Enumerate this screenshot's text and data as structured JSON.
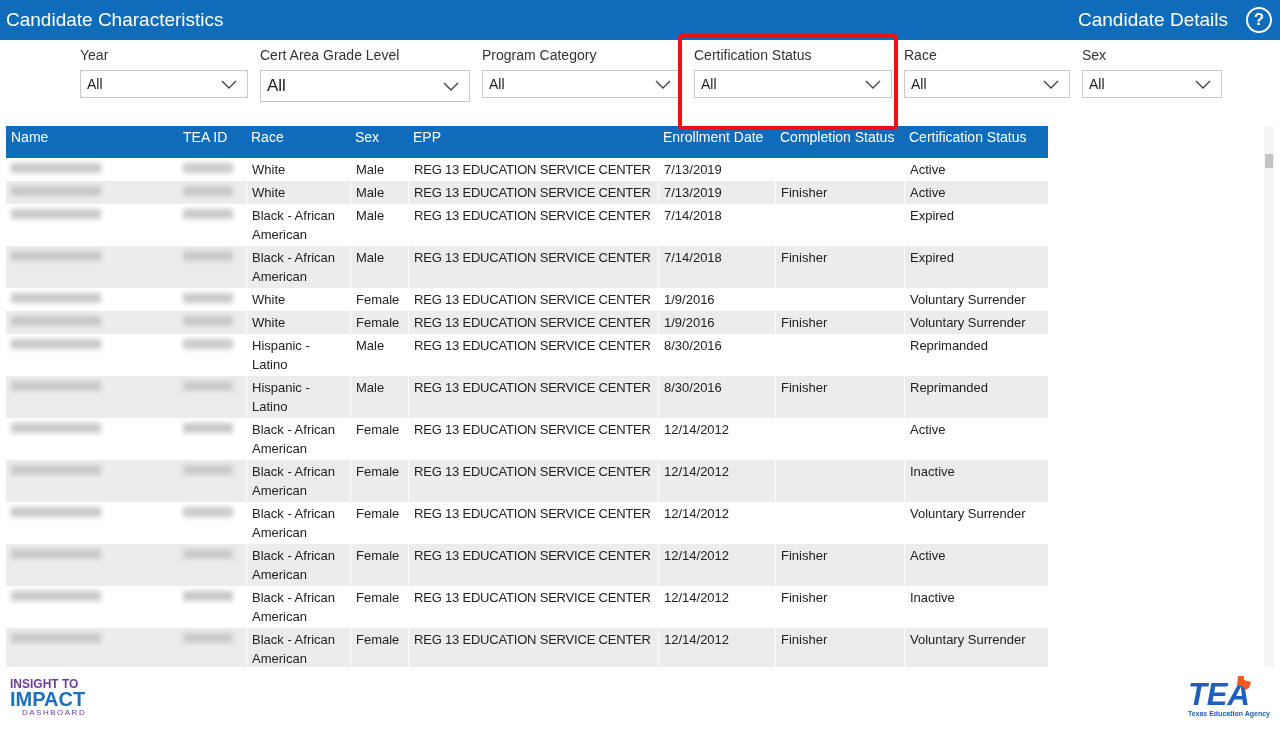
{
  "header": {
    "title": "Candidate Characteristics",
    "link": "Candidate Details",
    "help": "?"
  },
  "filters": [
    {
      "label": "Year",
      "value": "All",
      "highlighted": false,
      "large": false
    },
    {
      "label": "Cert Area Grade Level",
      "value": "All",
      "highlighted": false,
      "large": true
    },
    {
      "label": "Program Category",
      "value": "All",
      "highlighted": false,
      "large": false
    },
    {
      "label": "Certification Status",
      "value": "All",
      "highlighted": true,
      "large": false
    },
    {
      "label": "Race",
      "value": "All",
      "highlighted": false,
      "large": false
    },
    {
      "label": "Sex",
      "value": "All",
      "highlighted": false,
      "large": false
    }
  ],
  "table": {
    "columns": [
      "Name",
      "TEA ID",
      "Race",
      "Sex",
      "EPP",
      "Enrollment Date",
      "Completion Status",
      "Certification Status"
    ],
    "rows": [
      {
        "race": "White",
        "sex": "Male",
        "epp": "REG 13 EDUCATION SERVICE CENTER",
        "enrollment": "7/13/2019",
        "completion": "",
        "certification": "Active"
      },
      {
        "race": "White",
        "sex": "Male",
        "epp": "REG 13 EDUCATION SERVICE CENTER",
        "enrollment": "7/13/2019",
        "completion": "Finisher",
        "certification": "Active"
      },
      {
        "race": "Black - African American",
        "sex": "Male",
        "epp": "REG 13 EDUCATION SERVICE CENTER",
        "enrollment": "7/14/2018",
        "completion": "",
        "certification": "Expired"
      },
      {
        "race": "Black - African American",
        "sex": "Male",
        "epp": "REG 13 EDUCATION SERVICE CENTER",
        "enrollment": "7/14/2018",
        "completion": "Finisher",
        "certification": "Expired"
      },
      {
        "race": "White",
        "sex": "Female",
        "epp": "REG 13 EDUCATION SERVICE CENTER",
        "enrollment": "1/9/2016",
        "completion": "",
        "certification": "Voluntary Surrender"
      },
      {
        "race": "White",
        "sex": "Female",
        "epp": "REG 13 EDUCATION SERVICE CENTER",
        "enrollment": "1/9/2016",
        "completion": "Finisher",
        "certification": "Voluntary Surrender"
      },
      {
        "race": "Hispanic - Latino",
        "sex": "Male",
        "epp": "REG 13 EDUCATION SERVICE CENTER",
        "enrollment": "8/30/2016",
        "completion": "",
        "certification": "Reprimanded"
      },
      {
        "race": "Hispanic - Latino",
        "sex": "Male",
        "epp": "REG 13 EDUCATION SERVICE CENTER",
        "enrollment": "8/30/2016",
        "completion": "Finisher",
        "certification": "Reprimanded"
      },
      {
        "race": "Black - African American",
        "sex": "Female",
        "epp": "REG 13 EDUCATION SERVICE CENTER",
        "enrollment": "12/14/2012",
        "completion": "",
        "certification": "Active"
      },
      {
        "race": "Black - African American",
        "sex": "Female",
        "epp": "REG 13 EDUCATION SERVICE CENTER",
        "enrollment": "12/14/2012",
        "completion": "",
        "certification": "Inactive"
      },
      {
        "race": "Black - African American",
        "sex": "Female",
        "epp": "REG 13 EDUCATION SERVICE CENTER",
        "enrollment": "12/14/2012",
        "completion": "",
        "certification": "Voluntary Surrender"
      },
      {
        "race": "Black - African American",
        "sex": "Female",
        "epp": "REG 13 EDUCATION SERVICE CENTER",
        "enrollment": "12/14/2012",
        "completion": "Finisher",
        "certification": "Active"
      },
      {
        "race": "Black - African American",
        "sex": "Female",
        "epp": "REG 13 EDUCATION SERVICE CENTER",
        "enrollment": "12/14/2012",
        "completion": "Finisher",
        "certification": "Inactive"
      },
      {
        "race": "Black - African American",
        "sex": "Female",
        "epp": "REG 13 EDUCATION SERVICE CENTER",
        "enrollment": "12/14/2012",
        "completion": "Finisher",
        "certification": "Voluntary Surrender"
      }
    ]
  },
  "footer": {
    "left_logo": {
      "line1": "INSIGHT TO",
      "line2": "IMPACT",
      "line3": "DASHBOARD"
    },
    "right_logo": {
      "mark": "TEA",
      "caption": "Texas Education Agency"
    }
  }
}
